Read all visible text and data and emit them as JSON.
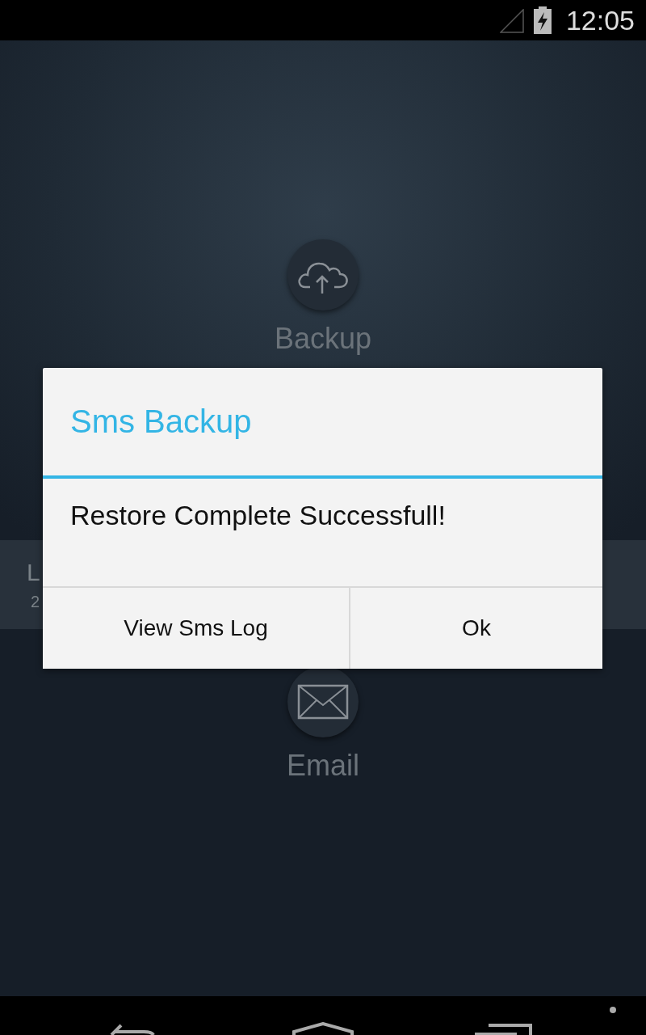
{
  "status_bar": {
    "time": "12:05"
  },
  "actions": [
    {
      "kind": "backup",
      "label": "Backup"
    },
    {
      "kind": "email",
      "label": "Email"
    }
  ],
  "info_band": {
    "title": "L",
    "subtitle": "2"
  },
  "dialog": {
    "title": "Sms Backup",
    "message": "Restore Complete Successfull!",
    "buttons": [
      "View Sms Log",
      "Ok"
    ]
  }
}
